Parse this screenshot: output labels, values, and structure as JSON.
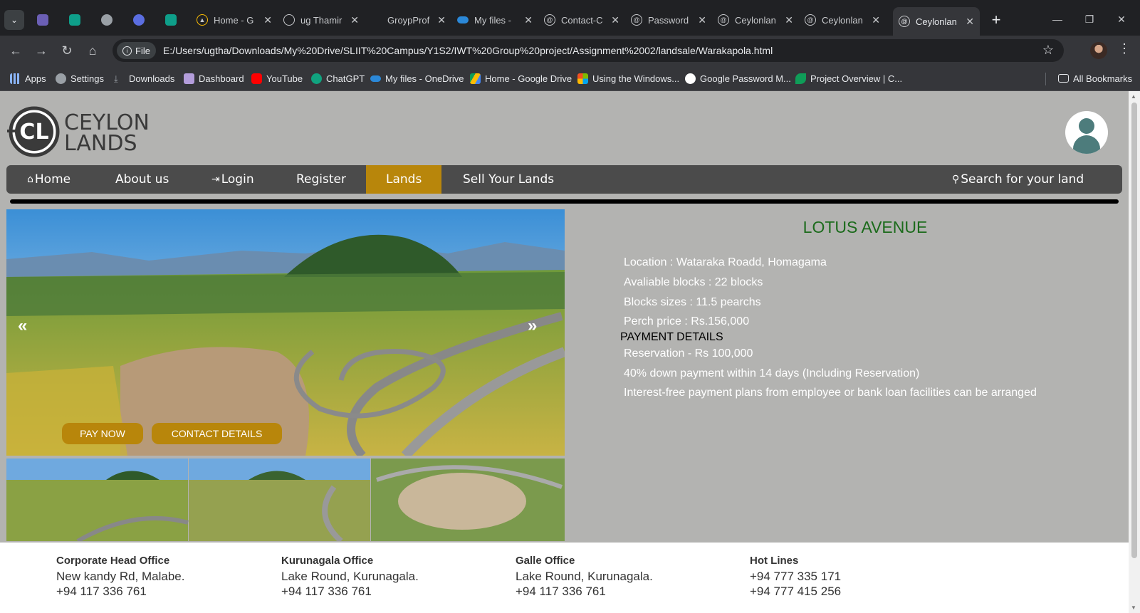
{
  "browser": {
    "tabs": [
      {
        "title": "Home - G"
      },
      {
        "title": "ug Thamir"
      },
      {
        "title": "GroypProf"
      },
      {
        "title": "My files -"
      },
      {
        "title": "Contact-C"
      },
      {
        "title": "Password"
      },
      {
        "title": "Ceylonlan"
      },
      {
        "title": "Ceylonlan"
      },
      {
        "title": "Ceylonlan"
      }
    ],
    "file_chip": "File",
    "url": "E:/Users/ugtha/Downloads/My%20Drive/SLIIT%20Campus/Y1S2/IWT%20Group%20project/Assignment%2002/landsale/Warakapola.html",
    "bookmarks": [
      {
        "label": "Apps",
        "color": "#8ab4f8"
      },
      {
        "label": "Settings",
        "color": "#9aa0a6"
      },
      {
        "label": "Downloads",
        "color": "#9aa0a6"
      },
      {
        "label": "Dashboard",
        "color": "#b39ddb"
      },
      {
        "label": "YouTube",
        "color": "#ff0000"
      },
      {
        "label": "ChatGPT",
        "color": "#10a37f"
      },
      {
        "label": "My files - OneDrive",
        "color": "#2b88d8"
      },
      {
        "label": "Home - Google Drive",
        "color": "#fbbc04"
      },
      {
        "label": "Using the Windows...",
        "color": "#f25022"
      },
      {
        "label": "Google Password M...",
        "color": "#ffffff"
      },
      {
        "label": "Project Overview | C...",
        "color": "#0f9d58"
      }
    ],
    "all_bookmarks": "All Bookmarks"
  },
  "logo": {
    "line1": "CEYLON",
    "line2": "LANDS",
    "mark": "CL"
  },
  "nav": {
    "home": "Home",
    "about": "About us",
    "login": "Login",
    "register": "Register",
    "lands": "Lands",
    "sell": "Sell Your Lands",
    "search": "Search for your land"
  },
  "slider": {
    "prev": "«",
    "next": "»"
  },
  "buttons": {
    "pay_now": "PAY NOW",
    "contact": "CONTACT DETAILS"
  },
  "land": {
    "title": "LOTUS AVENUE",
    "location": "Location : Wataraka Roadd, Homagama",
    "blocks": "Avaliable blocks : 22 blocks",
    "sizes": "Blocks sizes : 11.5 pearchs",
    "price": "Perch price : Rs.156,000",
    "payment_heading": "PAYMENT DETAILS",
    "reservation": "Reservation - Rs 100,000",
    "down_payment": "40% down payment within 14 days (Including Reservation)",
    "plans": "Interest-free payment plans from employee or bank loan facilities can be arranged"
  },
  "footer": {
    "offices": [
      {
        "name": "Corporate Head Office",
        "line1": "New kandy Rd, Malabe.",
        "line2": "+94 117 336 761"
      },
      {
        "name": "Kurunagala Office",
        "line1": "Lake Round, Kurunagala.",
        "line2": "+94 117 336 761"
      },
      {
        "name": "Galle Office",
        "line1": "Lake Round, Kurunagala.",
        "line2": "+94 117 336 761"
      },
      {
        "name": "Hot Lines",
        "line1": "+94 777 335 171",
        "line2": "+94 777 415 256"
      }
    ]
  },
  "colors": {
    "accent": "#b8860b",
    "title_green": "#1c6b1c",
    "nav_bg": "#4b4b4b",
    "page_bg": "#b3b3b1"
  }
}
